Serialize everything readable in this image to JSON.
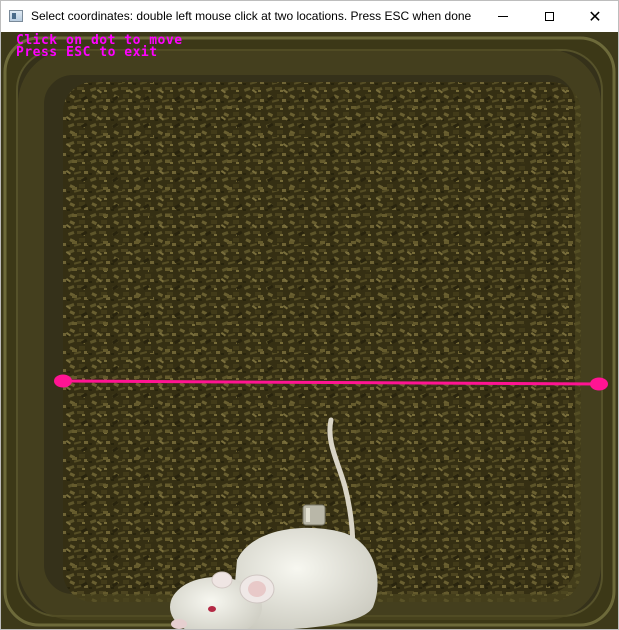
{
  "window": {
    "title": "Select coordinates: double left mouse click at two locations. Press ESC when done",
    "controls": {
      "minimize": "minimize",
      "maximize": "maximize",
      "close": "close"
    }
  },
  "overlay": {
    "line1": "Click on dot to move",
    "line2": "Press ESC to exit",
    "text_color": "#ff00ff"
  },
  "colors": {
    "marker": "#ff1493",
    "bedding_dark": "#2e2a12",
    "bedding_light": "#6b6233",
    "cage_edge": "#5a5a2a",
    "mouse": "#efefe8"
  },
  "icons": [
    "app-icon",
    "minimize-icon",
    "maximize-icon",
    "close-icon"
  ]
}
